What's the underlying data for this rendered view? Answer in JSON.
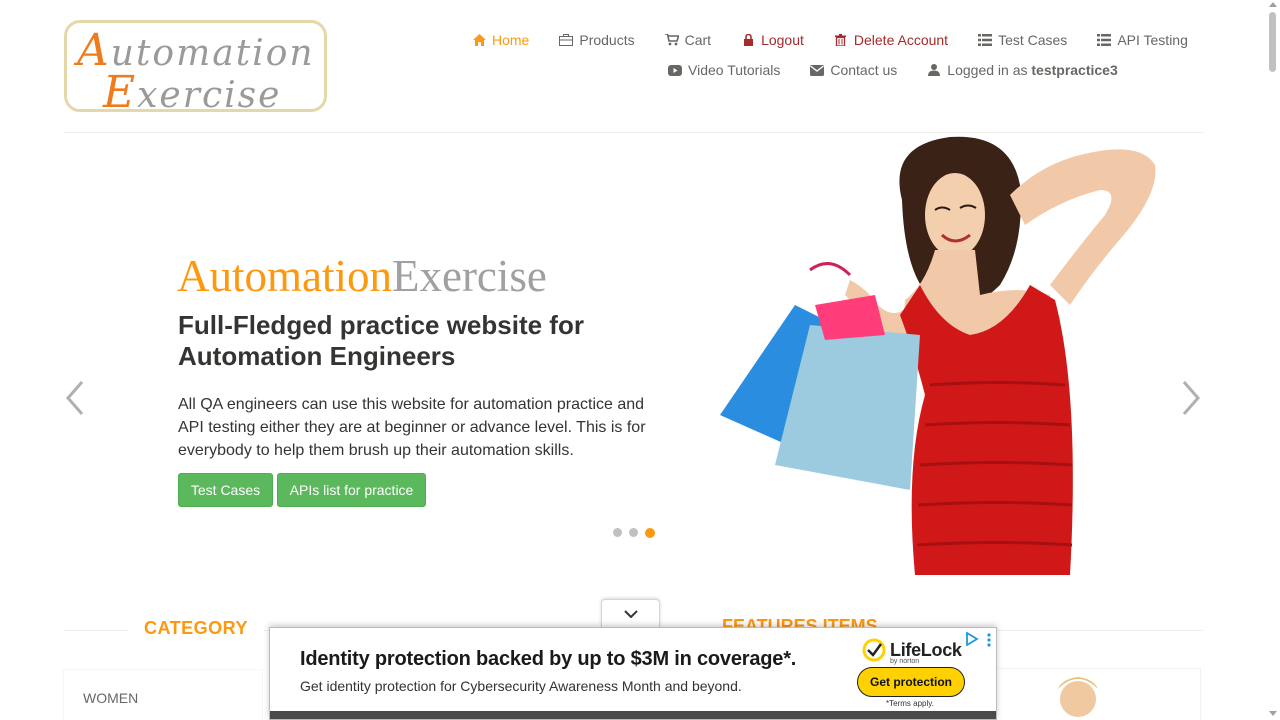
{
  "logo": {
    "line1_cap": "A",
    "line1_rest": "utomation",
    "line2_cap": "E",
    "line2_rest": "xercise"
  },
  "nav": {
    "home": "Home",
    "products": "Products",
    "cart": "Cart",
    "logout": "Logout",
    "delete_account": "Delete Account",
    "test_cases": "Test Cases",
    "api_testing": "API Testing",
    "video_tutorials": "Video Tutorials",
    "contact_us": "Contact us",
    "logged_in_prefix": "Logged in as",
    "username": "testpractice3"
  },
  "slider": {
    "brand_part1": "Automation",
    "brand_part2": "Exercise",
    "headline": "Full-Fledged practice website for Automation Engineers",
    "description": "All QA engineers can use this website for automation practice and API testing either they are at beginner or advance level. This is for everybody to help them brush up their automation skills.",
    "btn_test_cases": "Test Cases",
    "btn_apis": "APIs list for practice",
    "active_slide": 3,
    "slide_count": 3
  },
  "sections": {
    "category_title": "CATEGORY",
    "features_title": "FEATURES ITEMS",
    "category_first": "WOMEN"
  },
  "ad": {
    "headline": "Identity protection backed by up to $3M in coverage*.",
    "subtext": "Get identity protection for Cybersecurity Awareness Month and beyond.",
    "brand": "LifeLock",
    "brand_by": "by norton",
    "cta": "Get protection",
    "terms": "*Terms apply."
  },
  "colors": {
    "accent": "#fe980f",
    "danger": "#a52a2a",
    "green": "#5cb85c",
    "ad_yellow": "#ffd100"
  }
}
